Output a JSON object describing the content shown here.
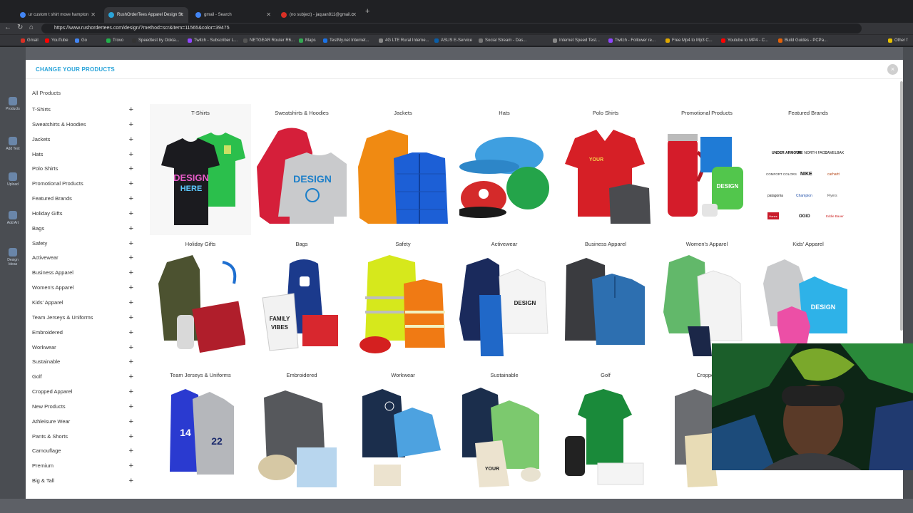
{
  "browser": {
    "tabs": [
      {
        "title": "ur custom t shirt move hampton",
        "active": false
      },
      {
        "title": "RushOrderTees Apparel Design St",
        "active": true
      },
      {
        "title": "gmail - Search",
        "active": false
      },
      {
        "title": "(no subject) - jaquan811@gmail.c",
        "active": false
      }
    ],
    "url": "https://www.rushordertees.com/design/?method=scr&item=11565&color=39475",
    "bookmarks": [
      "Gmail",
      "YouTube",
      "Go",
      "Trovo",
      "Speedtest by Ookla...",
      "Twitch - Subscriber L...",
      "NETGEAR Router R6...",
      "Maps",
      "TestMy.net Internet...",
      "4G LTE Rural Interne...",
      "ASUS E-Service",
      "Social Stream - Das...",
      "Internet Speed Test...",
      "Twitch - Follower re...",
      "Free Mp4 to Mp3 C...",
      "Youtube to MP4 - C...",
      "Build Guides - PCPa...",
      "Other f"
    ]
  },
  "left_strip": {
    "items": [
      "Products",
      "Add Text",
      "Upload",
      "Add Art",
      "Design Ideas"
    ]
  },
  "modal": {
    "title": "CHANGE YOUR PRODUCTS",
    "close": "×",
    "all_products": "All Products",
    "sidebar": [
      "T-Shirts",
      "Sweatshirts & Hoodies",
      "Jackets",
      "Hats",
      "Polo Shirts",
      "Promotional Products",
      "Featured Brands",
      "Holiday Gifts",
      "Bags",
      "Safety",
      "Activewear",
      "Business Apparel",
      "Women's Apparel",
      "Kids' Apparel",
      "Team Jerseys & Uniforms",
      "Embroidered",
      "Workwear",
      "Sustainable",
      "Golf",
      "Cropped Apparel",
      "New Products",
      "Athleisure Wear",
      "Pants & Shorts",
      "Camouflage",
      "Premium",
      "Big & Tall"
    ],
    "plus": "+",
    "categories": [
      "T-Shirts",
      "Sweatshirts & Hoodies",
      "Jackets",
      "Hats",
      "Polo Shirts",
      "Promotional Products",
      "Featured Brands",
      "Holiday Gifts",
      "Bags",
      "Safety",
      "Activewear",
      "Business Apparel",
      "Women's Apparel",
      "Kids' Apparel",
      "Team Jerseys & Uniforms",
      "Embroidered",
      "Workwear",
      "Sustainable",
      "Golf",
      "Cropped"
    ],
    "brands": [
      "UNDER ARMOUR",
      "THE NORTH FACE",
      "CAMELBAK",
      "COMFORT COLORS",
      "NIKE",
      "carhartt",
      "patagonia",
      "Champion",
      "Flyers",
      "Hanes",
      "OGIO",
      "Eddie Bauer"
    ],
    "img_text": {
      "design": "DESIGN",
      "here": "HERE",
      "your": "YOUR",
      "family": "FAMILY",
      "vibes": "VIBES",
      "jersey1": "14",
      "jersey2": "22"
    }
  },
  "colors": {
    "accent": "#2aa4d9",
    "modal_bg": "#ffffff",
    "overlay": "#5d6066"
  }
}
